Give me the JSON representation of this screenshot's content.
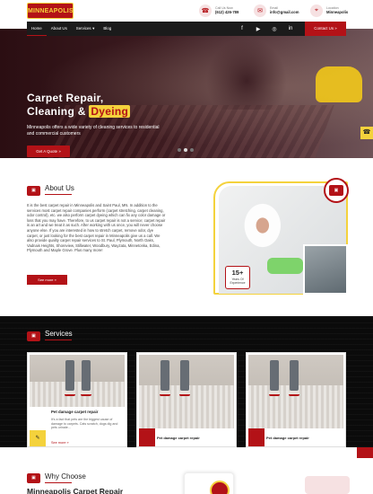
{
  "brand": {
    "logo_text": "MINNEAPOLIS"
  },
  "contacts": [
    {
      "icon": "phone-icon",
      "label": "Call Us Now",
      "value": "(612) 426-789"
    },
    {
      "icon": "mail-icon",
      "label": "Email",
      "value": "info@gmail.com"
    },
    {
      "icon": "location-icon",
      "label": "Location",
      "value": "Minneapolis"
    }
  ],
  "nav": {
    "items": [
      "Home",
      "About Us",
      "Services",
      "Blog"
    ],
    "services_caret": "▾",
    "contact_label": "Contact Us"
  },
  "hero": {
    "title_line1": "Carpet Repair,",
    "title_line2": "Cleaning &",
    "title_highlight": "Dyeing",
    "subtitle": "Minneapolis offers a wide variety of cleaning services to residential and commercial customers",
    "cta": "Get A Quote"
  },
  "about": {
    "title": "About Us",
    "body": "It is the best carpet repair in Minneapolis and Saint Paul, MN. In addition to the services most carpet repair companies perform (carpet stretching, carpet cleaning, odor control), etc. we also perform carpet dyeing which can fix any color damage or loss that you may have. Therefore, to us carpet repair is not a service; carpet repair is an art and we treat it as such. After working with us once, you will never choose anyone else. If you are interested in how to stretch carpet, remove odor, dye carpet, or just looking for the best carpet repair in Minneapolis give us a call. We also provide quality carpet repair services to St. Paul, Plymouth, North Oaks, Vadnais Heights, Shoreview, Stillwater, Woodbury, Wayzata, Minnetonka, Edina, Plymouth and Maple Grove. Plus many more!",
    "cta": "See more",
    "years_number": "15+",
    "years_label": "Years Of Experience"
  },
  "services": {
    "title": "Services",
    "cards": [
      {
        "title": "Pet damage carpet repair",
        "desc": "It's a fact that pets are the biggest cause of damage to carpets. Cats scratch, dogs dig and pets urinate...",
        "more": "See more"
      },
      {
        "title": "Pet damage carpet repair"
      },
      {
        "title": "Pet damage carpet repair"
      }
    ]
  },
  "why": {
    "title": "Why Choose",
    "subtitle": "Minneapolis Carpet Repair"
  },
  "colors": {
    "brand_red": "#b31217",
    "accent_yellow": "#f4d23c",
    "dark": "#1b1b1b"
  }
}
